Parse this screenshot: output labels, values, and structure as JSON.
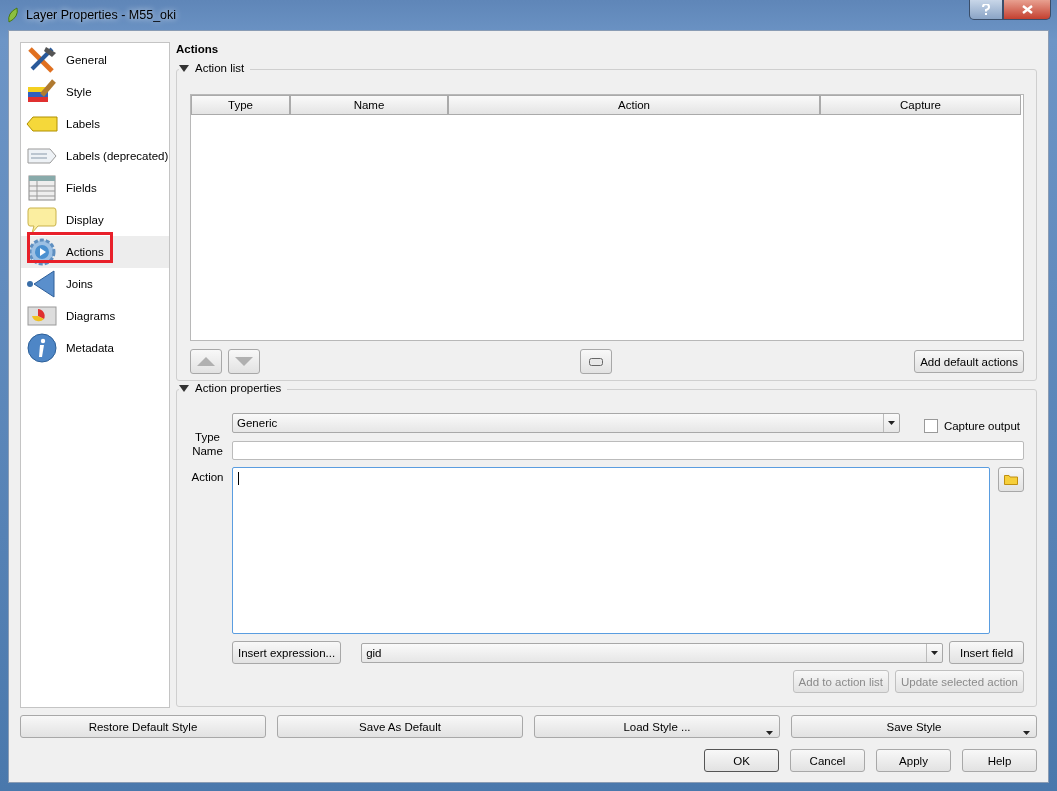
{
  "window": {
    "title": "Layer Properties - M55_oki"
  },
  "sidebar": {
    "items": [
      {
        "label": "General",
        "selected": false,
        "highlighted": false
      },
      {
        "label": "Style",
        "selected": false,
        "highlighted": false
      },
      {
        "label": "Labels",
        "selected": false,
        "highlighted": false
      },
      {
        "label": "Labels (deprecated)",
        "selected": false,
        "highlighted": false
      },
      {
        "label": "Fields",
        "selected": false,
        "highlighted": false
      },
      {
        "label": "Display",
        "selected": false,
        "highlighted": false
      },
      {
        "label": "Actions",
        "selected": true,
        "highlighted": true
      },
      {
        "label": "Joins",
        "selected": false,
        "highlighted": false
      },
      {
        "label": "Diagrams",
        "selected": false,
        "highlighted": false
      },
      {
        "label": "Metadata",
        "selected": false,
        "highlighted": false
      }
    ]
  },
  "heading": "Actions",
  "action_list": {
    "title": "Action list",
    "expanded": true,
    "columns": [
      "Type",
      "Name",
      "Action",
      "Capture"
    ],
    "add_default_button": "Add default actions"
  },
  "action_properties": {
    "title": "Action properties",
    "expanded": true,
    "type_label": "Type",
    "type_value": "Generic",
    "capture_output": {
      "label": "Capture output",
      "checked": false
    },
    "name_label": "Name",
    "action_label": "Action",
    "insert_expression_button": "Insert expression...",
    "field_value": "gid",
    "insert_field_button": "Insert field",
    "add_button": {
      "label": "Add to action list",
      "disabled": true
    },
    "update_button": {
      "label": "Update selected action",
      "disabled": true
    }
  },
  "style_buttons": [
    {
      "label": "Restore Default Style",
      "dropdown": false
    },
    {
      "label": "Save As Default",
      "dropdown": false
    },
    {
      "label": "Load Style ...",
      "dropdown": true
    },
    {
      "label": "Save Style",
      "dropdown": true
    }
  ],
  "dialog_buttons": [
    {
      "label": "OK",
      "default": true
    },
    {
      "label": "Cancel",
      "default": false
    },
    {
      "label": "Apply",
      "default": false
    },
    {
      "label": "Help",
      "default": false
    }
  ]
}
